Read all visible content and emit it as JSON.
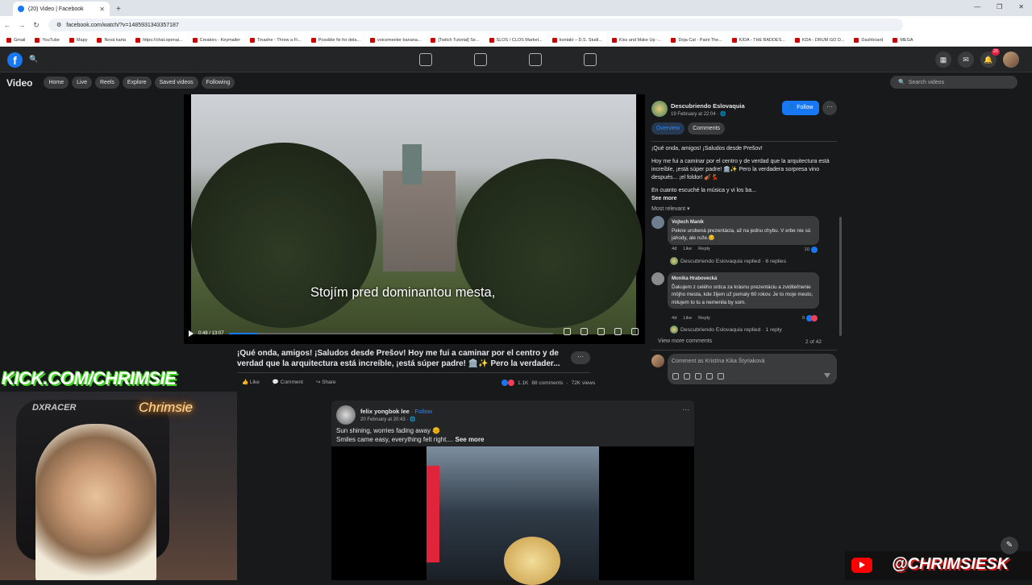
{
  "browser": {
    "tab_title": "(20) Video | Facebook",
    "url": "facebook.com/watch/?v=1485931343357187",
    "bookmarks": [
      "Gmail",
      "YouTube",
      "Mapy",
      "Nová karta",
      "https://chat.openai...",
      "Creators - Keymailer",
      "Tinashe - Throw a Fi...",
      "Possible fix for dela...",
      "voicemeeter banana...",
      "[Twitch Tutorial] Se...",
      "SLOS / CLOS Market...",
      "kontakt – D.S. Studi...",
      "Kiss and Make Up -...",
      "Doja Cat - Paint The...",
      "K/DA - THE BADDES...",
      "KDA - DRUM GO D...",
      "Dashboard",
      "MEGA"
    ]
  },
  "fb": {
    "notif_count": "20",
    "section_title": "Video",
    "subnav": [
      "Home",
      "Live",
      "Reels",
      "Explore",
      "Saved videos",
      "Following"
    ],
    "search_placeholder": "Search videos"
  },
  "video": {
    "caption": "Stojím pred dominantou mesta,",
    "time": "0:48 / 13:07",
    "progress": 0.09,
    "buffered": 0.09,
    "title": "¡Qué onda, amigos! ¡Saludos desde Prešov! Hoy me fui a caminar por el centro y de verdad que la arquitectura está increíble, ¡está súper padre! 🏛️✨ Pero la verdader...",
    "like": "Like",
    "comment": "Comment",
    "share": "Share",
    "reactions": "1.1K",
    "comments_count": "88 comments",
    "views": "72K views"
  },
  "panel": {
    "page_name": "Descubriendo Eslovaquia",
    "date": "19 February at 22:04 · 🌐",
    "follow": "Follow",
    "tabs": [
      "Overview",
      "Comments"
    ],
    "desc1": "¡Qué onda, amigos! ¡Saludos desde Prešov!",
    "desc2": "Hoy me fui a caminar por el centro y de verdad que la arquitectura está increíble, ¡está súper padre! 🏛️✨ Pero la verdadera sorpresa vino después... ¡el foldor! 🎻💃",
    "desc3": "En cuanto escuché la música y vi los ba...",
    "see_more": "See more",
    "most_relevant": "Most relevant ▾",
    "comments": [
      {
        "author": "Vojtech Maník",
        "text": "Pekne urobená prezentácia, až na jednu chybu. V erbe nie sú jahody, ale ruže.😊",
        "age": "4d",
        "like": "Like",
        "reply": "Reply",
        "reactions": "10",
        "replied": "Descubriendo Eslovaquia replied · 6 replies"
      },
      {
        "author": "Monika Hrabovecká",
        "text": "Ďakujem z celého srdca za krásnu prezentáciu a zviditeľnenie môjho mesta, kde žijem už pomaly 60 rokov. Je to moje mesto, milujem to tu a nemenila by som.",
        "age": "4d",
        "like": "Like",
        "reply": "Reply",
        "reactions": "9",
        "replied": "Descubriendo Eslovaquia replied · 1 reply"
      }
    ],
    "view_more": "View more comments",
    "count": "2 of 42",
    "comment_placeholder": "Comment as Kristína Kika Štyriaková"
  },
  "post": {
    "author": "felix yongbok lee",
    "follow": "· Follow",
    "date": "20 February at 20:43 · 🌐",
    "line1": "Sun shining, worries fading away 🌞",
    "line2": "Smiles came easy, everything felt right....",
    "see_more": "See more"
  },
  "overlay": {
    "kick": "KICK.COM/CHRIMSIE",
    "chair_brand": "DXRACER",
    "neon": "Chrimsie",
    "yt_handle": "@CHRIMSIESK"
  }
}
